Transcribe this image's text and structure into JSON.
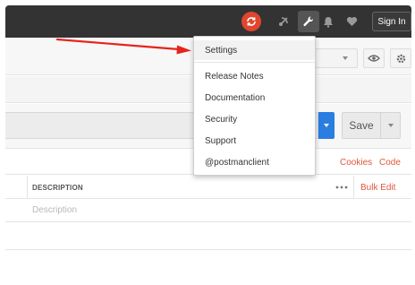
{
  "topbar": {
    "signin_label": "Sign In",
    "icons": [
      "sync-icon",
      "satellite-icon",
      "wrench-icon",
      "bell-icon",
      "heart-icon"
    ],
    "sync_color": "#e0462e"
  },
  "settings_menu": {
    "items": [
      {
        "label": "Settings"
      },
      {
        "label": "Release Notes"
      },
      {
        "label": "Documentation"
      },
      {
        "label": "Security"
      },
      {
        "label": "Support"
      },
      {
        "label": "@postmanclient"
      }
    ]
  },
  "request": {
    "save_label": "Save",
    "send_color": "#2a7de1"
  },
  "links": {
    "cookies": "Cookies",
    "code": "Code",
    "link_color": "#e0573c"
  },
  "params_table": {
    "header_description": "DESCRIPTION",
    "bulk_edit": "Bulk Edit",
    "description_placeholder": "Description"
  },
  "annotation": {
    "arrow_color": "#e8231b"
  }
}
